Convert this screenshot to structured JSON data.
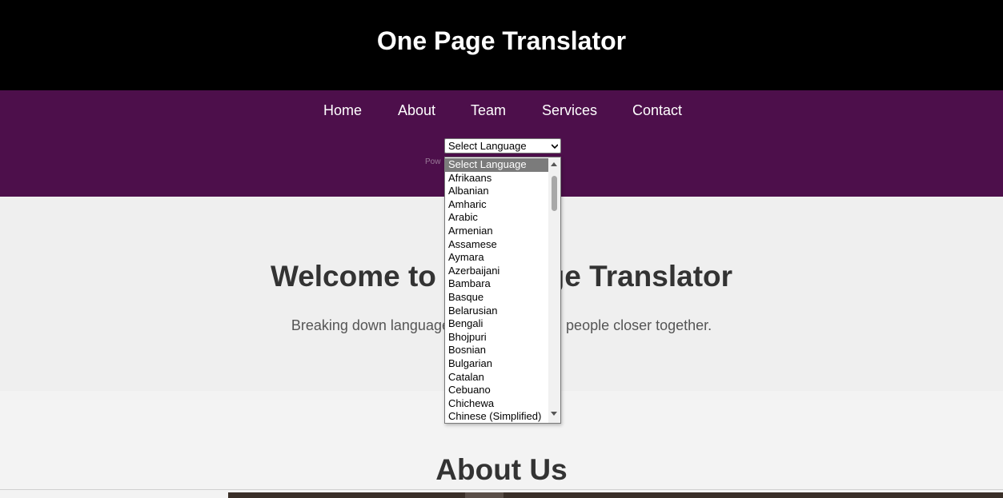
{
  "header": {
    "title": "One Page Translator"
  },
  "nav": {
    "items": [
      {
        "label": "Home"
      },
      {
        "label": "About"
      },
      {
        "label": "Team"
      },
      {
        "label": "Services"
      },
      {
        "label": "Contact"
      }
    ]
  },
  "translate": {
    "selected": "Select Language",
    "powered_by": "Pow",
    "options": [
      "Select Language",
      "Afrikaans",
      "Albanian",
      "Amharic",
      "Arabic",
      "Armenian",
      "Assamese",
      "Aymara",
      "Azerbaijani",
      "Bambara",
      "Basque",
      "Belarusian",
      "Bengali",
      "Bhojpuri",
      "Bosnian",
      "Bulgarian",
      "Catalan",
      "Cebuano",
      "Chichewa",
      "Chinese (Simplified)"
    ]
  },
  "hero": {
    "title": "Welcome to One Page Translator",
    "subtitle": "Breaking down language barriers, bringing people closer together."
  },
  "about": {
    "title": "About Us"
  },
  "colors": {
    "header_bg": "#000000",
    "nav_bg": "#4d0f4b",
    "hero_bg": "#efefef"
  }
}
